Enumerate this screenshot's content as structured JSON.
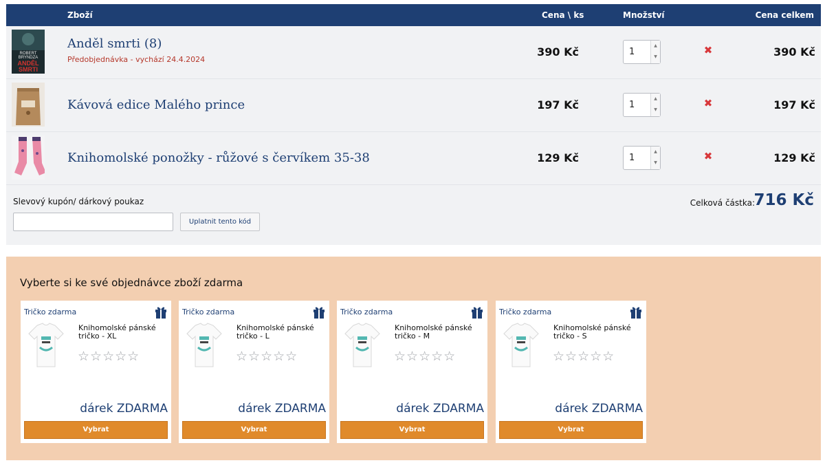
{
  "cart": {
    "headers": {
      "goods": "Zboží",
      "unit_price": "Cena \\ ks",
      "quantity": "Množství",
      "total": "Cena celkem"
    },
    "items": [
      {
        "name": "Anděl smrti (8)",
        "note": "Předobjednávka - vychází 24.4.2024",
        "unit_price": "390 Kč",
        "quantity": "1",
        "line_total": "390 Kč",
        "cover_text": [
          "ROBERT",
          "BRYNDZA",
          "ANDĚL",
          "SMRTI"
        ]
      },
      {
        "name": "Kávová edice Malého prince",
        "note": "",
        "unit_price": "197 Kč",
        "quantity": "1",
        "line_total": "197 Kč"
      },
      {
        "name": "Knihomolské ponožky - růžové s červíkem 35-38",
        "note": "",
        "unit_price": "129 Kč",
        "quantity": "1",
        "line_total": "129 Kč"
      }
    ],
    "remove_icon": "red-x-icon",
    "coupon": {
      "label": "Slevový kupón/ dárkový poukaz",
      "value": "",
      "button": "Uplatnit tento kód"
    },
    "summary": {
      "label": "Celková částka:",
      "value": "716 Kč"
    }
  },
  "gifts": {
    "title": "Vyberte si ke své objednávce zboží zdarma",
    "items": [
      {
        "tag": "Tričko zdarma",
        "name": "Knihomolské pánské tričko - XL",
        "rating": 0,
        "price": "dárek ZDARMA",
        "button": "Vybrat"
      },
      {
        "tag": "Tričko zdarma",
        "name": "Knihomolské pánské tričko - L",
        "rating": 0,
        "price": "dárek ZDARMA",
        "button": "Vybrat"
      },
      {
        "tag": "Tričko zdarma",
        "name": "Knihomolské pánské tričko - M",
        "rating": 0,
        "price": "dárek ZDARMA",
        "button": "Vybrat"
      },
      {
        "tag": "Tričko zdarma",
        "name": "Knihomolské pánské tričko - S",
        "rating": 0,
        "price": "dárek ZDARMA",
        "button": "Vybrat"
      }
    ]
  },
  "colors": {
    "header_bg": "#1e3f73",
    "accent_text": "#1e3f73",
    "preorder_note": "#b5372a",
    "remove_icon": "#d8373a",
    "gifts_panel_bg": "#f3cfb1",
    "choose_button": "#e08a2b"
  }
}
